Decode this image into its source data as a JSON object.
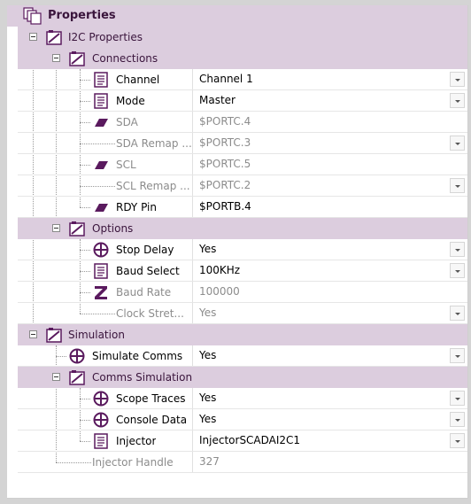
{
  "root_title": "Properties",
  "sections": {
    "i2c": "I2C Properties",
    "connections": "Connections",
    "options": "Options",
    "simulation": "Simulation",
    "comms_sim": "Comms Simulation"
  },
  "rows": [
    {
      "name": "Channel",
      "value": "Channel 1"
    },
    {
      "name": "Mode",
      "value": "Master"
    },
    {
      "name": "SDA",
      "value": "$PORTC.4"
    },
    {
      "name": "SDA Remap ...",
      "value": "$PORTC.3"
    },
    {
      "name": "SCL",
      "value": "$PORTC.5"
    },
    {
      "name": "SCL Remap ...",
      "value": "$PORTC.2"
    },
    {
      "name": "RDY Pin",
      "value": "$PORTB.4"
    },
    {
      "name": "Stop Delay",
      "value": "Yes"
    },
    {
      "name": "Baud Select",
      "value": "100KHz"
    },
    {
      "name": "Baud Rate",
      "value": "100000"
    },
    {
      "name": "Clock Stret...",
      "value": "Yes"
    },
    {
      "name": "Simulate Comms",
      "value": "Yes"
    },
    {
      "name": "Scope Traces",
      "value": "Yes"
    },
    {
      "name": "Console Data",
      "value": "Yes"
    },
    {
      "name": "Injector",
      "value": "InjectorSCADAI2C1"
    },
    {
      "name": "Injector Handle",
      "value": "327"
    }
  ],
  "colors": {
    "section_bg": "#dccdde",
    "accent": "#5a1a5e",
    "disabled_text": "#8c8c8c"
  }
}
